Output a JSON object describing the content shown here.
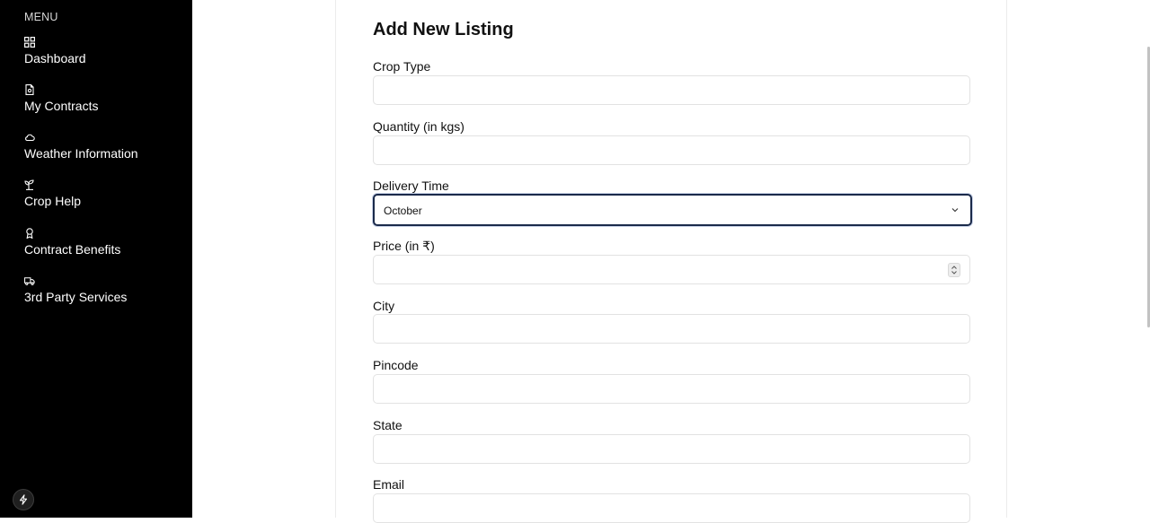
{
  "sidebar": {
    "menu_label": "MENU",
    "items": [
      {
        "label": "Dashboard",
        "icon": "dashboard-icon"
      },
      {
        "label": "My Contracts",
        "icon": "document-icon"
      },
      {
        "label": "Weather Information",
        "icon": "cloud-icon"
      },
      {
        "label": "Crop Help",
        "icon": "sprout-icon"
      },
      {
        "label": "Contract Benefits",
        "icon": "award-icon"
      },
      {
        "label": "3rd Party Services",
        "icon": "truck-icon"
      }
    ],
    "footer_icon": "bolt-icon"
  },
  "form": {
    "title": "Add New Listing",
    "crop_type": {
      "label": "Crop Type",
      "value": ""
    },
    "quantity": {
      "label": "Quantity (in kgs)",
      "value": ""
    },
    "delivery_time": {
      "label": "Delivery Time",
      "value": "October"
    },
    "price": {
      "label": "Price (in ₹)",
      "value": ""
    },
    "city": {
      "label": "City",
      "value": ""
    },
    "pincode": {
      "label": "Pincode",
      "value": ""
    },
    "state": {
      "label": "State",
      "value": ""
    },
    "email": {
      "label": "Email",
      "value": ""
    }
  }
}
